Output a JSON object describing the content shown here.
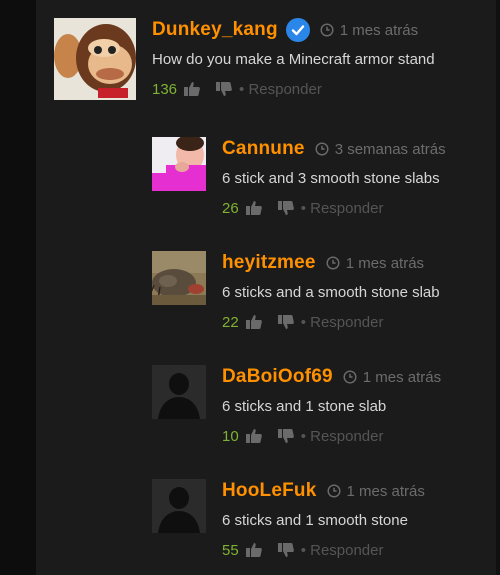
{
  "comments": [
    {
      "username": "Dunkey_kang",
      "verified": true,
      "timestamp": "1 mes atrás",
      "text": "How do you make a Minecraft armor stand",
      "votes": "136",
      "reply_label": "• Responder",
      "avatar": "donkey-kong-avatar"
    },
    {
      "username": "Cannune",
      "verified": false,
      "timestamp": "3 semanas atrás",
      "text": "6 stick and 3 smooth stone slabs",
      "votes": "26",
      "reply_label": "• Responder",
      "avatar": "pink-photo-avatar"
    },
    {
      "username": "heyitzmee",
      "verified": false,
      "timestamp": "1 mes atrás",
      "text": "6 sticks and a smooth stone slab",
      "votes": "22",
      "reply_label": "• Responder",
      "avatar": "catfish-avatar"
    },
    {
      "username": "DaBoiOof69",
      "verified": false,
      "timestamp": "1 mes atrás",
      "text": "6 sticks and 1 stone slab",
      "votes": "10",
      "reply_label": "• Responder",
      "avatar": "default-avatar"
    },
    {
      "username": "HooLeFuk",
      "verified": false,
      "timestamp": "1 mes atrás",
      "text": "6 sticks and 1 smooth stone",
      "votes": "55",
      "reply_label": "• Responder",
      "avatar": "default-avatar"
    }
  ],
  "colors": {
    "username": "#ff9000",
    "votes": "#7fb233",
    "timestamp": "#6c6c6c",
    "text": "#d6d6d6",
    "background": "#1b1b1b"
  }
}
